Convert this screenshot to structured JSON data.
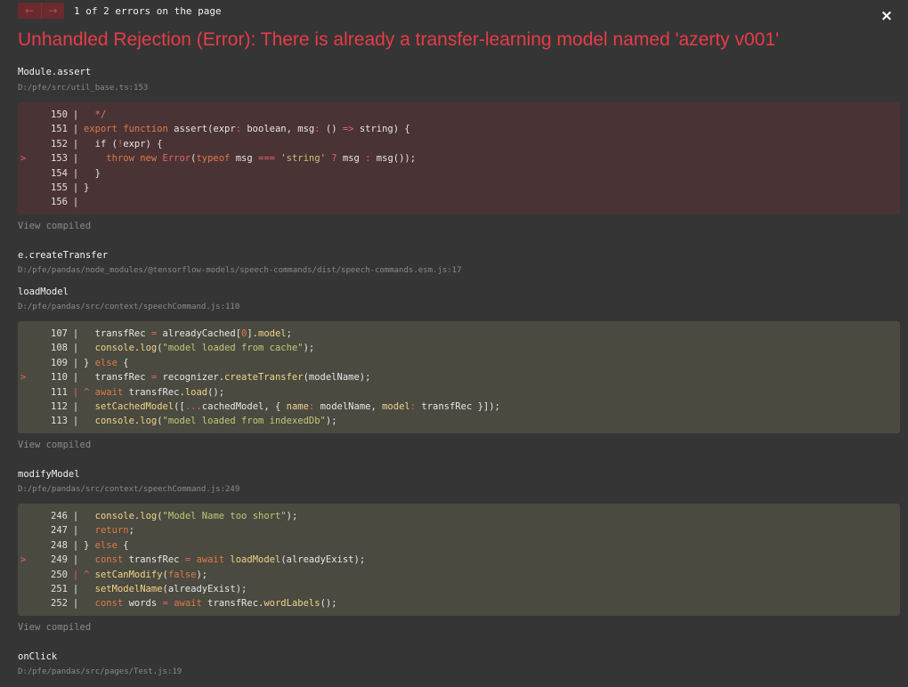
{
  "header": {
    "prev_label": "←",
    "next_label": "→",
    "counter": "1 of 2 errors on the page",
    "close_label": "×"
  },
  "error": {
    "title": "Unhandled Rejection (Error): There is already a transfer-learning model named 'azerty v001'"
  },
  "frames": [
    {
      "name": "Module.assert",
      "location": "D:/pfe/src/util_base.ts:153",
      "variant": "err",
      "view_compiled": "View compiled",
      "lines": [
        {
          "num": "150",
          "marker": "",
          "gutter": "|",
          "code": [
            {
              "t": "  "
            },
            {
              "t": "*/",
              "c": "cm"
            }
          ]
        },
        {
          "num": "151",
          "marker": "",
          "gutter": "|",
          "code": [
            {
              "t": "export function ",
              "c": "kw"
            },
            {
              "t": "assert(expr"
            },
            {
              "t": ":",
              "c": "op"
            },
            {
              "t": " boolean, msg"
            },
            {
              "t": ":",
              "c": "op"
            },
            {
              "t": " () "
            },
            {
              "t": "=>",
              "c": "op"
            },
            {
              "t": " string) {"
            }
          ]
        },
        {
          "num": "152",
          "marker": "",
          "gutter": "|",
          "code": [
            {
              "t": "  if ("
            },
            {
              "t": "!",
              "c": "op"
            },
            {
              "t": "expr) {"
            }
          ]
        },
        {
          "num": "153",
          "marker": ">",
          "gutter": "|",
          "code": [
            {
              "t": "    "
            },
            {
              "t": "throw new ",
              "c": "kw"
            },
            {
              "t": "Error",
              "c": "op"
            },
            {
              "t": "("
            },
            {
              "t": "typeof ",
              "c": "kw"
            },
            {
              "t": "msg "
            },
            {
              "t": "===",
              "c": "op"
            },
            {
              "t": " "
            },
            {
              "t": "'string'",
              "c": "str"
            },
            {
              "t": " "
            },
            {
              "t": "?",
              "c": "op"
            },
            {
              "t": " msg "
            },
            {
              "t": ":",
              "c": "op"
            },
            {
              "t": " msg());"
            }
          ]
        },
        {
          "num": "154",
          "marker": "",
          "gutter": "|",
          "code": [
            {
              "t": "  }"
            }
          ]
        },
        {
          "num": "155",
          "marker": "",
          "gutter": "|",
          "code": [
            {
              "t": "}"
            }
          ]
        },
        {
          "num": "156",
          "marker": "",
          "gutter": "|",
          "code": [
            {
              "t": ""
            }
          ]
        }
      ]
    },
    {
      "name": "e.createTransfer",
      "location": "D:/pfe/pandas/node_modules/@tensorflow-models/speech-commands/dist/speech-commands.esm.js:17",
      "variant": "none",
      "lines": []
    },
    {
      "name": "loadModel",
      "location": "D:/pfe/pandas/src/context/speechCommand.js:110",
      "variant": "app",
      "view_compiled": "View compiled",
      "lines": [
        {
          "num": "107",
          "marker": "",
          "gutter": "|",
          "code": [
            {
              "t": "  transfRec "
            },
            {
              "t": "=",
              "c": "op"
            },
            {
              "t": " alreadyCached["
            },
            {
              "t": "0",
              "c": "kw"
            },
            {
              "t": "]."
            },
            {
              "t": "model",
              "c": "prop"
            },
            {
              "t": ";"
            }
          ]
        },
        {
          "num": "108",
          "marker": "",
          "gutter": "|",
          "code": [
            {
              "t": "  "
            },
            {
              "t": "console",
              "c": "prop"
            },
            {
              "t": "."
            },
            {
              "t": "log",
              "c": "prop"
            },
            {
              "t": "("
            },
            {
              "t": "\"model loaded from cache\"",
              "c": "str"
            },
            {
              "t": ");"
            }
          ]
        },
        {
          "num": "109",
          "marker": "",
          "gutter": "|",
          "code": [
            {
              "t": "} "
            },
            {
              "t": "else",
              "c": "kw"
            },
            {
              "t": " {"
            }
          ]
        },
        {
          "num": "110",
          "marker": ">",
          "gutter": "|",
          "code": [
            {
              "t": "  transfRec "
            },
            {
              "t": "=",
              "c": "op"
            },
            {
              "t": " recognizer."
            },
            {
              "t": "createTransfer",
              "c": "prop"
            },
            {
              "t": "(modelName);"
            }
          ]
        },
        {
          "num": "111",
          "marker": "",
          "gutter": "|",
          "gutter_hl": true,
          "code": [
            {
              "t": "^ ",
              "c": "op"
            },
            {
              "t": "await ",
              "c": "kw"
            },
            {
              "t": "transfRec."
            },
            {
              "t": "load",
              "c": "prop"
            },
            {
              "t": "();"
            }
          ]
        },
        {
          "num": "112",
          "marker": "",
          "gutter": "|",
          "code": [
            {
              "t": "  "
            },
            {
              "t": "setCachedModel",
              "c": "prop"
            },
            {
              "t": "(["
            },
            {
              "t": "...",
              "c": "op"
            },
            {
              "t": "cachedModel, { "
            },
            {
              "t": "name",
              "c": "prop"
            },
            {
              "t": ":",
              "c": "op"
            },
            {
              "t": " modelName, "
            },
            {
              "t": "model",
              "c": "prop"
            },
            {
              "t": ":",
              "c": "op"
            },
            {
              "t": " transfRec }]);"
            }
          ]
        },
        {
          "num": "113",
          "marker": "",
          "gutter": "|",
          "code": [
            {
              "t": "  "
            },
            {
              "t": "console",
              "c": "prop"
            },
            {
              "t": "."
            },
            {
              "t": "log",
              "c": "prop"
            },
            {
              "t": "("
            },
            {
              "t": "\"model loaded from indexedDb\"",
              "c": "str"
            },
            {
              "t": ");"
            }
          ]
        }
      ]
    },
    {
      "name": "modifyModel",
      "location": "D:/pfe/pandas/src/context/speechCommand.js:249",
      "variant": "app",
      "view_compiled": "View compiled",
      "lines": [
        {
          "num": "246",
          "marker": "",
          "gutter": "|",
          "code": [
            {
              "t": "  "
            },
            {
              "t": "console",
              "c": "prop"
            },
            {
              "t": "."
            },
            {
              "t": "log",
              "c": "prop"
            },
            {
              "t": "("
            },
            {
              "t": "\"Model Name too short\"",
              "c": "str"
            },
            {
              "t": ");"
            }
          ]
        },
        {
          "num": "247",
          "marker": "",
          "gutter": "|",
          "code": [
            {
              "t": "  "
            },
            {
              "t": "return",
              "c": "kw"
            },
            {
              "t": ";"
            }
          ]
        },
        {
          "num": "248",
          "marker": "",
          "gutter": "|",
          "code": [
            {
              "t": "} "
            },
            {
              "t": "else",
              "c": "kw"
            },
            {
              "t": " {"
            }
          ]
        },
        {
          "num": "249",
          "marker": ">",
          "gutter": "|",
          "code": [
            {
              "t": "  "
            },
            {
              "t": "const ",
              "c": "kw"
            },
            {
              "t": "transfRec "
            },
            {
              "t": "=",
              "c": "op"
            },
            {
              "t": " "
            },
            {
              "t": "await ",
              "c": "kw"
            },
            {
              "t": "loadModel",
              "c": "prop"
            },
            {
              "t": "(alreadyExist);"
            }
          ]
        },
        {
          "num": "250",
          "marker": "",
          "gutter": "|",
          "gutter_hl": true,
          "code": [
            {
              "t": "^ ",
              "c": "op"
            },
            {
              "t": "setCanModify",
              "c": "prop"
            },
            {
              "t": "("
            },
            {
              "t": "false",
              "c": "kw"
            },
            {
              "t": ");"
            }
          ]
        },
        {
          "num": "251",
          "marker": "",
          "gutter": "|",
          "code": [
            {
              "t": "  "
            },
            {
              "t": "setModelName",
              "c": "prop"
            },
            {
              "t": "(alreadyExist);"
            }
          ]
        },
        {
          "num": "252",
          "marker": "",
          "gutter": "|",
          "code": [
            {
              "t": "  "
            },
            {
              "t": "const ",
              "c": "kw"
            },
            {
              "t": "words "
            },
            {
              "t": "=",
              "c": "op"
            },
            {
              "t": " "
            },
            {
              "t": "await ",
              "c": "kw"
            },
            {
              "t": "transfRec."
            },
            {
              "t": "wordLabels",
              "c": "prop"
            },
            {
              "t": "();"
            }
          ]
        }
      ]
    },
    {
      "name": "onClick",
      "location": "D:/pfe/pandas/src/pages/Test.js:19",
      "variant": "none",
      "lines": []
    }
  ]
}
